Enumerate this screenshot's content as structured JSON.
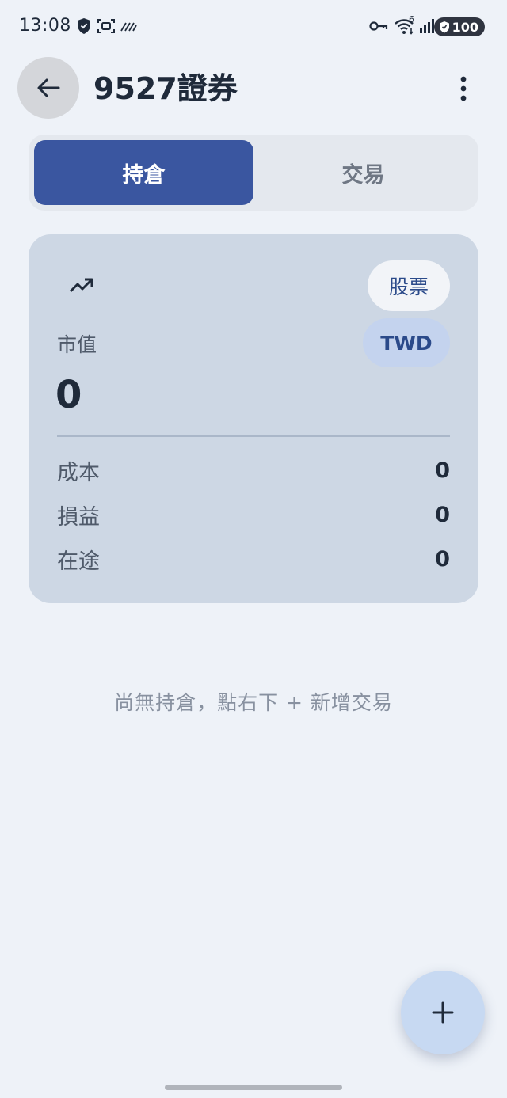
{
  "status_bar": {
    "time": "13:08",
    "battery_level": "100",
    "signal_badge": "6",
    "icons": [
      "shield-icon",
      "screen-record-icon",
      "data-saver-icon",
      "vpn-key-icon",
      "wifi-icon",
      "cellular-signal-icon",
      "battery-icon"
    ]
  },
  "header": {
    "title": "9527證券",
    "back_icon": "arrow-left-icon",
    "menu_icon": "more-vertical-icon"
  },
  "tabs": [
    {
      "label": "持倉",
      "active": true
    },
    {
      "label": "交易",
      "active": false
    }
  ],
  "summary": {
    "icon": "trending-up-icon",
    "type_chip": "股票",
    "currency_chip": "TWD",
    "market_value_label": "市值",
    "market_value": "0",
    "rows": [
      {
        "label": "成本",
        "value": "0"
      },
      {
        "label": "損益",
        "value": "0"
      },
      {
        "label": "在途",
        "value": "0"
      }
    ]
  },
  "empty_state": {
    "message": "尚無持倉，點右下 + 新增交易"
  },
  "fab": {
    "icon": "plus-icon"
  },
  "colors": {
    "background": "#eef2f8",
    "accent": "#3a56a0",
    "card": "#cdd7e4",
    "fab": "#c7d9f2"
  }
}
